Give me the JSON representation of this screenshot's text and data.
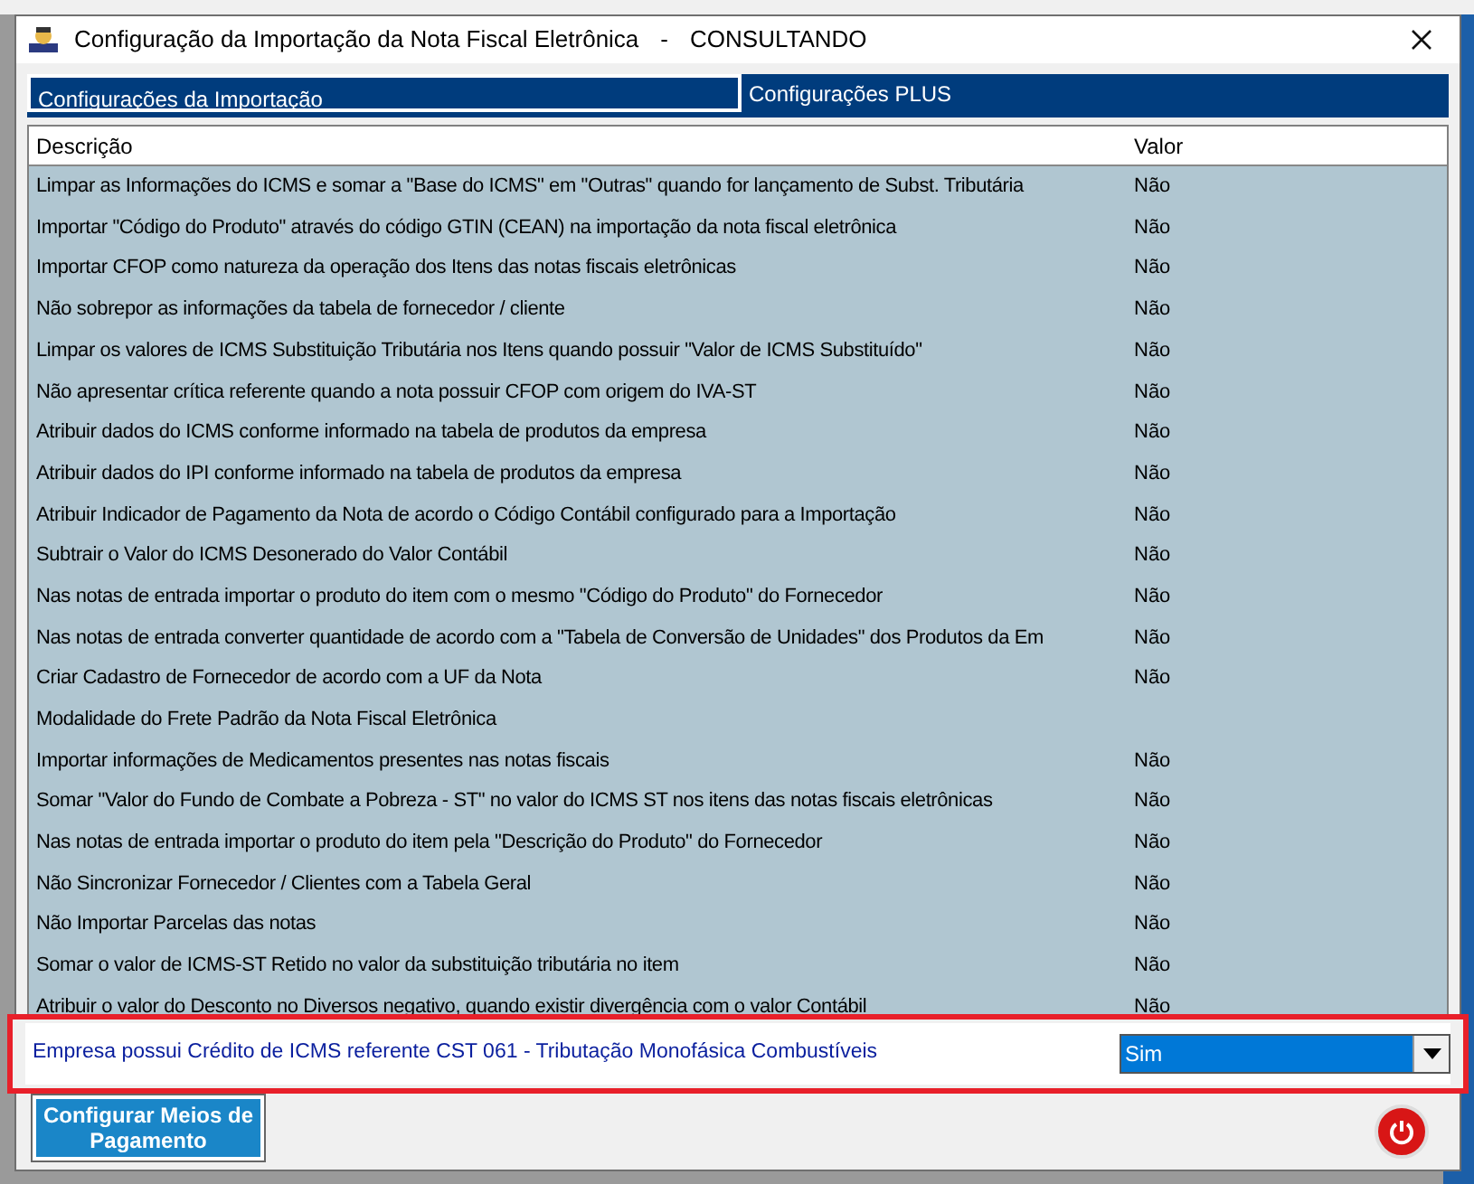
{
  "window": {
    "title": "Configuração da Importação da Nota Fiscal Eletrônica",
    "separator": "-",
    "mode": "CONSULTANDO"
  },
  "tabs": [
    {
      "label": "Configurações da Importação",
      "selected": true
    },
    {
      "label": "Configurações PLUS",
      "selected": false
    }
  ],
  "table": {
    "columns": [
      "Descrição",
      "Valor"
    ],
    "rows": [
      {
        "description": "Limpar as Informações do ICMS e somar a \"Base do ICMS\" em \"Outras\" quando for lançamento de Subst. Tributária",
        "value": "Não"
      },
      {
        "description": "Importar \"Código do Produto\" através do código GTIN (CEAN) na importação da nota fiscal eletrônica",
        "value": "Não"
      },
      {
        "description": "Importar CFOP como natureza da operação dos Itens das notas fiscais eletrônicas",
        "value": "Não"
      },
      {
        "description": "Não sobrepor as informações da tabela de fornecedor / cliente",
        "value": "Não"
      },
      {
        "description": "Limpar os valores de ICMS Substituição Tributária nos Itens quando possuir \"Valor de ICMS Substituído\"",
        "value": "Não"
      },
      {
        "description": "Não apresentar crítica referente quando a nota possuir CFOP com origem do IVA-ST",
        "value": "Não"
      },
      {
        "description": "Atribuir dados do ICMS conforme informado na tabela de produtos da empresa",
        "value": "Não"
      },
      {
        "description": "Atribuir dados do IPI conforme informado na tabela de produtos da empresa",
        "value": "Não"
      },
      {
        "description": "Atribuir Indicador de Pagamento da Nota de acordo o Código Contábil configurado para a Importação",
        "value": "Não"
      },
      {
        "description": "Subtrair o Valor do ICMS Desonerado do Valor Contábil",
        "value": "Não"
      },
      {
        "description": "Nas notas de entrada importar o produto do item com o mesmo \"Código do Produto\" do Fornecedor",
        "value": "Não"
      },
      {
        "description": "Nas notas de entrada converter quantidade de acordo com a \"Tabela de Conversão de Unidades\" dos Produtos da Em",
        "value": "Não"
      },
      {
        "description": "Criar Cadastro de Fornecedor de acordo com a UF da Nota",
        "value": "Não"
      },
      {
        "description": "Modalidade do Frete Padrão da Nota Fiscal Eletrônica"
      },
      {
        "description": "Importar informações de Medicamentos presentes nas notas fiscais",
        "value": "Não"
      },
      {
        "description": "Somar \"Valor do Fundo de Combate a Pobreza - ST\" no valor do ICMS ST nos itens das notas fiscais eletrônicas",
        "value": "Não"
      },
      {
        "description": "Nas notas de entrada importar o produto do item pela \"Descrição do Produto\" do Fornecedor",
        "value": "Não"
      },
      {
        "description": "Não Sincronizar Fornecedor / Clientes com a Tabela Geral",
        "value": "Não"
      },
      {
        "description": "Não Importar Parcelas das notas",
        "value": "Não"
      },
      {
        "description": "Somar o valor de ICMS-ST Retido no valor da substituição tributária no item",
        "value": "Não"
      },
      {
        "description": "Atribuir o valor do Desconto no Diversos negativo, quando existir divergência com o valor Contábil",
        "value": "Não"
      }
    ],
    "editing_row": {
      "description": "Empresa possui Crédito de ICMS referente CST 061 - Tributação Monofásica Combustíveis",
      "value": "Sim"
    }
  },
  "buttons": {
    "configure": "Configurar Meios de Pagamento"
  }
}
